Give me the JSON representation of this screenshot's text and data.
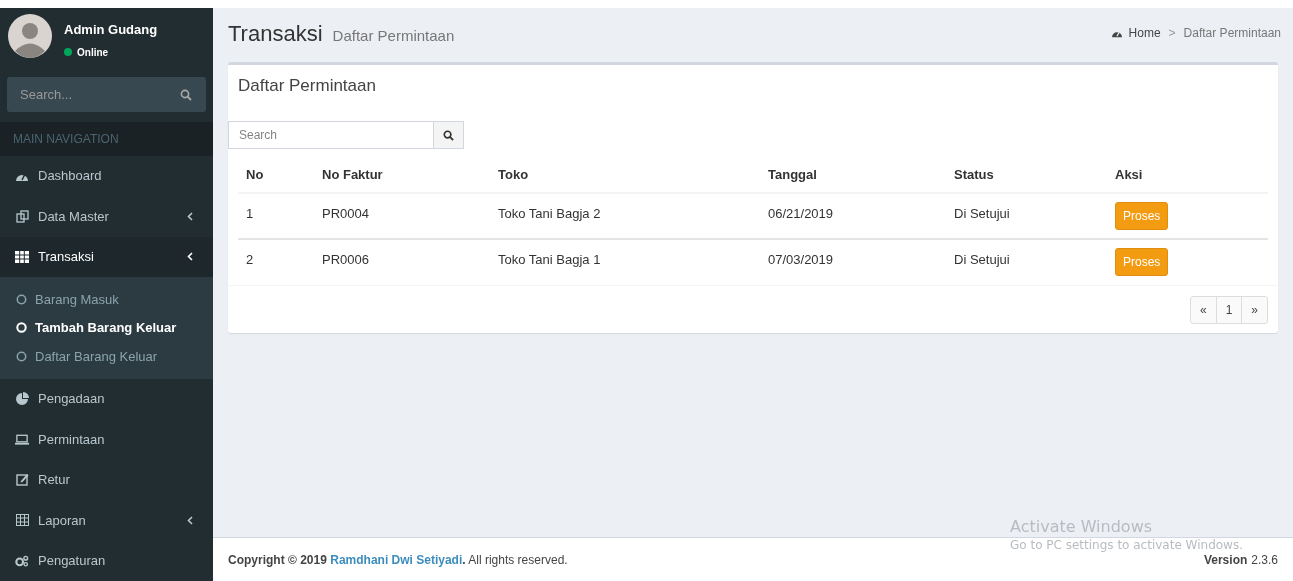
{
  "user": {
    "name": "Admin Gudang",
    "status": "Online"
  },
  "sidebar_search": {
    "placeholder": "Search..."
  },
  "nav_header": "MAIN NAVIGATION",
  "menu": [
    {
      "label": "Dashboard",
      "selected": false,
      "collapsible": false
    },
    {
      "label": "Data Master",
      "selected": false,
      "collapsible": true
    },
    {
      "label": "Transaksi",
      "selected": true,
      "collapsible": true,
      "children": [
        {
          "label": "Barang Masuk",
          "selected": false
        },
        {
          "label": "Tambah Barang Keluar",
          "selected": true
        },
        {
          "label": "Daftar Barang Keluar",
          "selected": false
        }
      ]
    },
    {
      "label": "Pengadaan",
      "selected": false,
      "collapsible": false
    },
    {
      "label": "Permintaan",
      "selected": false,
      "collapsible": false
    },
    {
      "label": "Retur",
      "selected": false,
      "collapsible": false
    },
    {
      "label": "Laporan",
      "selected": false,
      "collapsible": true
    },
    {
      "label": "Pengaturan",
      "selected": false,
      "collapsible": false
    }
  ],
  "page": {
    "title": "Transaksi",
    "subtitle": "Daftar Permintaan"
  },
  "breadcrumb": [
    "Home",
    "Daftar Permintaan"
  ],
  "breadcrumb_separator": ">",
  "box": {
    "title": "Daftar Permintaan",
    "search": {
      "placeholder": "Search"
    },
    "table": {
      "columns": [
        "No",
        "No Faktur",
        "Toko",
        "Tanggal",
        "Status",
        "Aksi"
      ],
      "rows": [
        [
          "1",
          "PR0004",
          "Toko Tani Bagja 2",
          "06/21/2019",
          "Di Setujui",
          "Proses"
        ],
        [
          "2",
          "PR0006",
          "Toko Tani Bagja 1",
          "07/03/2019",
          "Di Setujui",
          "Proses"
        ]
      ]
    },
    "pagination": [
      "«",
      "1",
      "»"
    ]
  },
  "footer": {
    "copyright": "Copyright © 2019",
    "author": "Ramdhani Dwi Setiyadi",
    "rights": "**.** All rights reserved.",
    "version_label": "Version",
    "version": "2.3.6"
  },
  "os_notice": {
    "title": "Activate Windows",
    "text": "Go to PC settings to activate Windows."
  }
}
